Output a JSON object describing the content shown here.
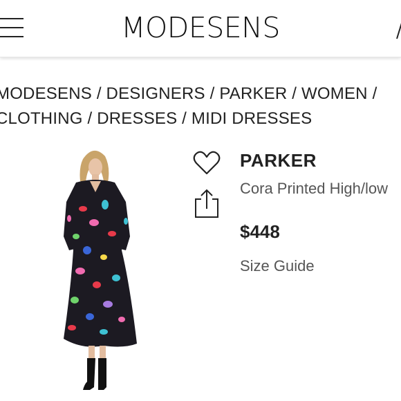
{
  "header": {
    "logo": "MODESENS"
  },
  "breadcrumb": {
    "line1": "MODESENS / DESIGNERS / PARKER / WOMEN /",
    "line2": "CLOTHING / DRESSES / MIDI DRESSES"
  },
  "product": {
    "brand": "PARKER",
    "name": "Cora Printed High/low",
    "price": "$448",
    "size_guide": "Size Guide"
  },
  "icons": {
    "menu": "hamburger-menu-icon",
    "account": "account-icon",
    "favorite": "heart-icon",
    "share": "share-icon"
  },
  "colors": {
    "text": "#222222",
    "secondary_text": "#555555",
    "dress_base": "#1c1a22"
  }
}
